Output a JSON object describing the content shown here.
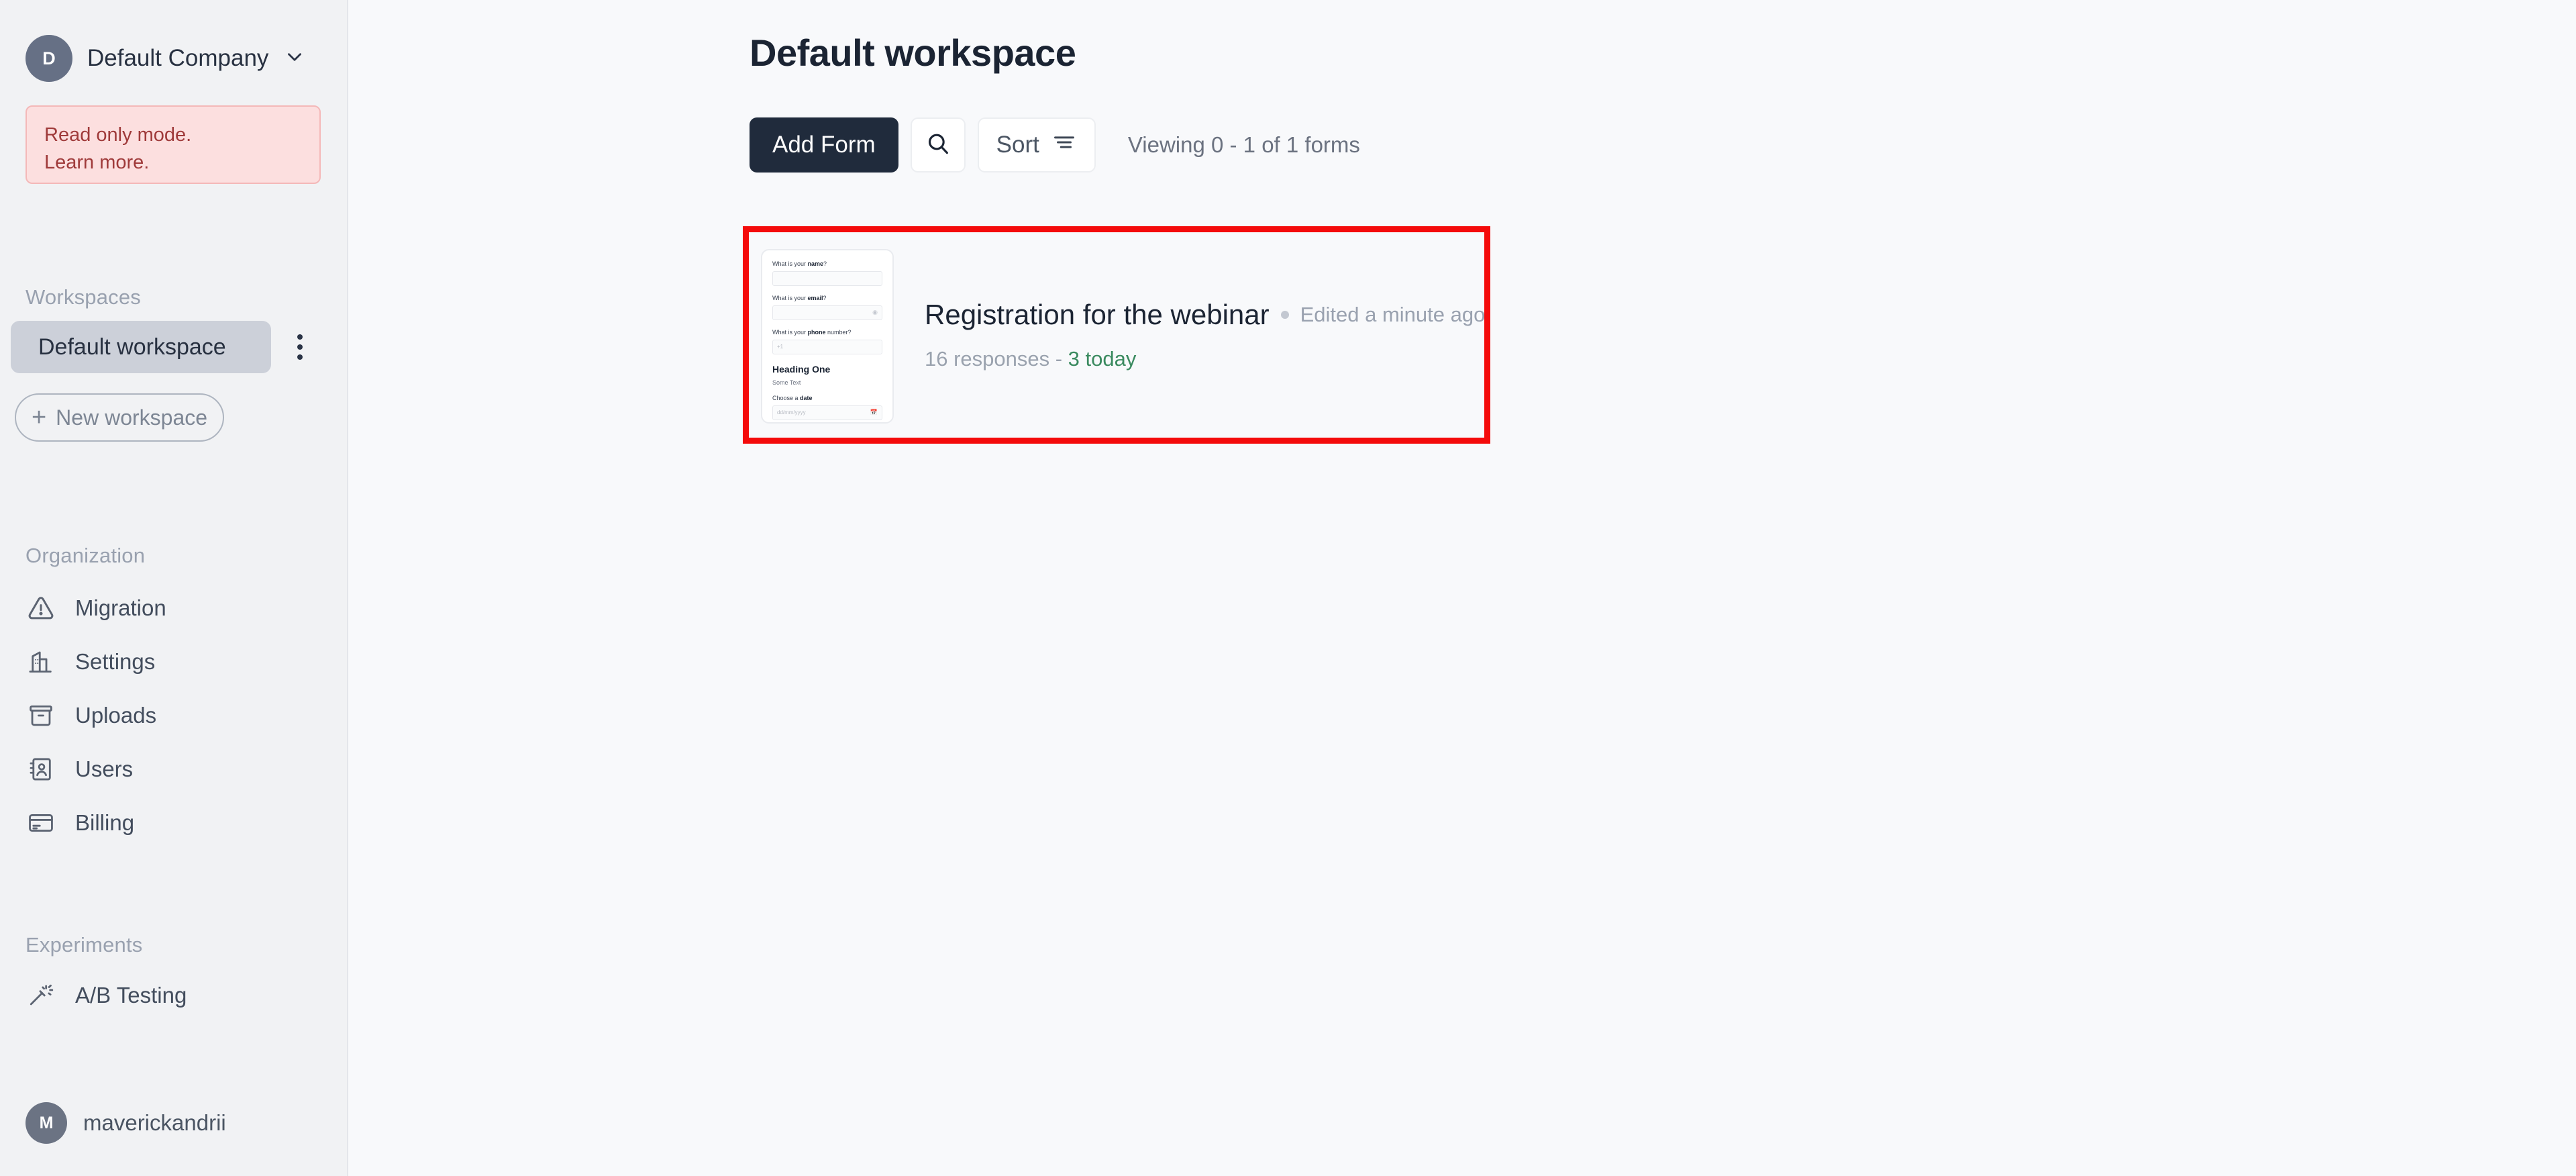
{
  "sidebar": {
    "org": {
      "initial": "D",
      "name": "Default Company",
      "chevron_icon": "chevron-down-icon"
    },
    "readonly_notice": {
      "line1": "Read only mode.",
      "line2": "Learn more."
    },
    "workspaces_label": "Workspaces",
    "workspace_item": {
      "label": "Default workspace",
      "selected": true
    },
    "new_workspace_label": "New workspace",
    "organization_label": "Organization",
    "org_items": [
      {
        "label": "Migration",
        "icon": "warning-triangle-icon"
      },
      {
        "label": "Settings",
        "icon": "building-icon"
      },
      {
        "label": "Uploads",
        "icon": "archive-box-icon"
      },
      {
        "label": "Users",
        "icon": "contact-book-icon"
      },
      {
        "label": "Billing",
        "icon": "credit-card-icon"
      }
    ],
    "experiments_label": "Experiments",
    "experiment_items": [
      {
        "label": "A/B Testing",
        "icon": "magic-wand-icon"
      }
    ],
    "user": {
      "initial": "M",
      "name": "maverickandrii"
    }
  },
  "main": {
    "page_title": "Default workspace",
    "toolbar": {
      "add_form_label": "Add Form",
      "search_icon": "search-icon",
      "sort_label": "Sort",
      "sort_icon": "sort-lines-icon",
      "viewing_text": "Viewing 0 - 1 of 1 forms"
    },
    "form_card": {
      "title": "Registration for the webinar",
      "edited_text": "Edited a minute ago",
      "responses_text": "16 responses - ",
      "today_text": "3 today",
      "highlight_color": "#f40b0b",
      "today_color": "#3a8a5f",
      "thumbnail": {
        "q1_prefix": "What is your ",
        "q1_bold": "name",
        "q1_suffix": "?",
        "q2_prefix": "What is your ",
        "q2_bold": "email",
        "q2_suffix": "?",
        "q2_field_icon": "at-sign-icon",
        "q3_prefix": "What is your ",
        "q3_bold": "phone",
        "q3_suffix": " number?",
        "q3_placeholder": "+1",
        "heading": "Heading One",
        "body_text": "Some Text",
        "q4_prefix": "Choose a ",
        "q4_bold": "date",
        "q4_suffix": "",
        "q4_placeholder": "dd/mm/yyyy",
        "q4_field_icon": "calendar-icon"
      }
    }
  },
  "fabs": {
    "chat_icon": "chat-bubble-icon",
    "help_label": "?"
  }
}
